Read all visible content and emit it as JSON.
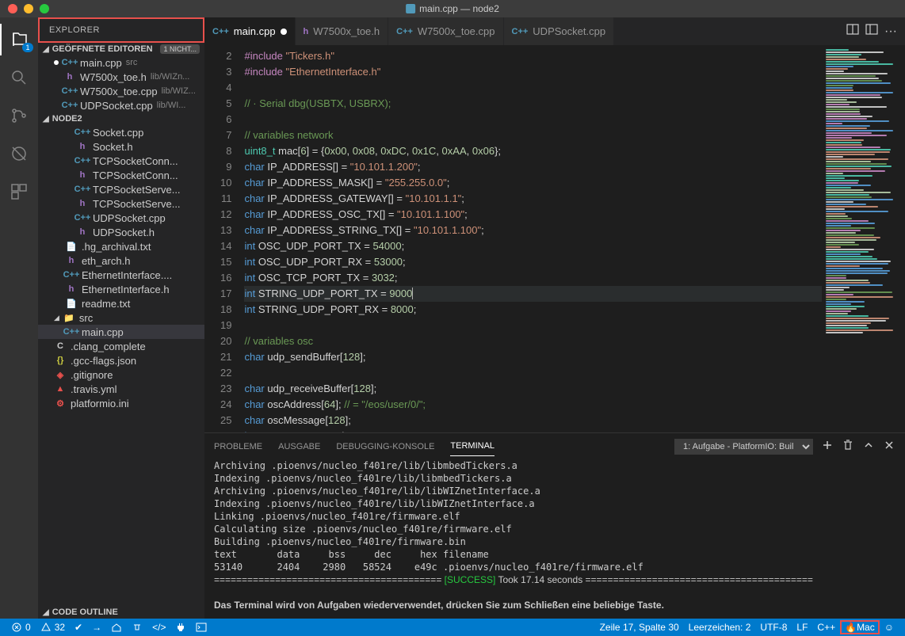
{
  "titlebar": {
    "title": "main.cpp — node2"
  },
  "activity": {
    "explorer_badge": "1"
  },
  "sidebar": {
    "title": "EXPLORER",
    "sections": {
      "openEditors": {
        "label": "Geöffnete Editoren",
        "tag": "1 NICHT..."
      },
      "project": {
        "label": "NODE2"
      },
      "outline": {
        "label": "Code Outline"
      }
    },
    "openEditorItems": [
      {
        "icon": "C++",
        "cls": "cpp",
        "name": "main.cpp",
        "detail": "src",
        "dirty": true
      },
      {
        "icon": "h",
        "cls": "h",
        "name": "W7500x_toe.h",
        "detail": "lib/WIZn..."
      },
      {
        "icon": "C++",
        "cls": "cpp",
        "name": "W7500x_toe.cpp",
        "detail": "lib/WIZ..."
      },
      {
        "icon": "C++",
        "cls": "cpp",
        "name": "UDPSocket.cpp",
        "detail": "lib/WI..."
      }
    ],
    "tree": [
      {
        "icon": "C++",
        "cls": "cpp",
        "name": "Socket.cpp",
        "lvl": 2
      },
      {
        "icon": "h",
        "cls": "h",
        "name": "Socket.h",
        "lvl": 2
      },
      {
        "icon": "C++",
        "cls": "cpp",
        "name": "TCPSocketConn...",
        "lvl": 2
      },
      {
        "icon": "h",
        "cls": "h",
        "name": "TCPSocketConn...",
        "lvl": 2
      },
      {
        "icon": "C++",
        "cls": "cpp",
        "name": "TCPSocketServe...",
        "lvl": 2
      },
      {
        "icon": "h",
        "cls": "h",
        "name": "TCPSocketServe...",
        "lvl": 2
      },
      {
        "icon": "C++",
        "cls": "cpp",
        "name": "UDPSocket.cpp",
        "lvl": 2
      },
      {
        "icon": "h",
        "cls": "h",
        "name": "UDPSocket.h",
        "lvl": 2
      },
      {
        "icon": "📄",
        "cls": "txt",
        "name": ".hg_archival.txt",
        "lvl": 1
      },
      {
        "icon": "h",
        "cls": "h",
        "name": "eth_arch.h",
        "lvl": 1
      },
      {
        "icon": "C++",
        "cls": "cpp",
        "name": "EthernetInterface....",
        "lvl": 1
      },
      {
        "icon": "h",
        "cls": "h",
        "name": "EthernetInterface.h",
        "lvl": 1
      },
      {
        "icon": "📄",
        "cls": "txt",
        "name": "readme.txt",
        "lvl": 1
      },
      {
        "icon": "▸",
        "cls": "folder",
        "name": "src",
        "lvl": 0,
        "folder": true,
        "open": true
      },
      {
        "icon": "C++",
        "cls": "cpp",
        "name": "main.cpp",
        "lvl": 1,
        "selected": true
      },
      {
        "icon": "C",
        "cls": "txt",
        "name": ".clang_complete",
        "lvl": 0
      },
      {
        "icon": "{}",
        "cls": "json",
        "name": ".gcc-flags.json",
        "lvl": 0
      },
      {
        "icon": "◈",
        "cls": "git",
        "name": ".gitignore",
        "lvl": 0
      },
      {
        "icon": "▲",
        "cls": "yml",
        "name": ".travis.yml",
        "lvl": 0
      },
      {
        "icon": "⚙",
        "cls": "ini",
        "name": "platformio.ini",
        "lvl": 0
      }
    ]
  },
  "tabs": [
    {
      "icon": "C++",
      "cls": "cpp",
      "name": "main.cpp",
      "active": true,
      "dirty": true
    },
    {
      "icon": "h",
      "cls": "h",
      "name": "W7500x_toe.h"
    },
    {
      "icon": "C++",
      "cls": "cpp",
      "name": "W7500x_toe.cpp"
    },
    {
      "icon": "C++",
      "cls": "cpp",
      "name": "UDPSocket.cpp"
    }
  ],
  "editor": {
    "startLine": 2
  },
  "panel": {
    "tabs": {
      "problems": "PROBLEME",
      "output": "AUSGABE",
      "debug": "DEBUGGING-KONSOLE",
      "terminal": "TERMINAL"
    },
    "select": "1: Aufgabe - PlatformIO: Buil",
    "terminal": [
      "Archiving .pioenvs/nucleo_f401re/lib/libmbedTickers.a",
      "Indexing .pioenvs/nucleo_f401re/lib/libmbedTickers.a",
      "Archiving .pioenvs/nucleo_f401re/lib/libWIZnetInterface.a",
      "Indexing .pioenvs/nucleo_f401re/lib/libWIZnetInterface.a",
      "Linking .pioenvs/nucleo_f401re/firmware.elf",
      "Calculating size .pioenvs/nucleo_f401re/firmware.elf",
      "Building .pioenvs/nucleo_f401re/firmware.bin",
      "text       data     bss     dec     hex filename",
      "53140      2404    2980   58524    e49c .pioenvs/nucleo_f401re/firmware.elf"
    ],
    "successLine": {
      "prefix": "=========================================",
      "success": "[SUCCESS]",
      "suffix": " Took 17.14 seconds ========================================="
    },
    "closeHint": "Das Terminal wird von Aufgaben wiederverwendet, drücken Sie zum Schließen eine beliebige Taste."
  },
  "statusbar": {
    "errors": "0",
    "warnings": "32",
    "position": "Zeile 17, Spalte 30",
    "spaces": "Leerzeichen: 2",
    "encoding": "UTF-8",
    "eol": "LF",
    "lang": "C++",
    "mac": "Mac"
  }
}
